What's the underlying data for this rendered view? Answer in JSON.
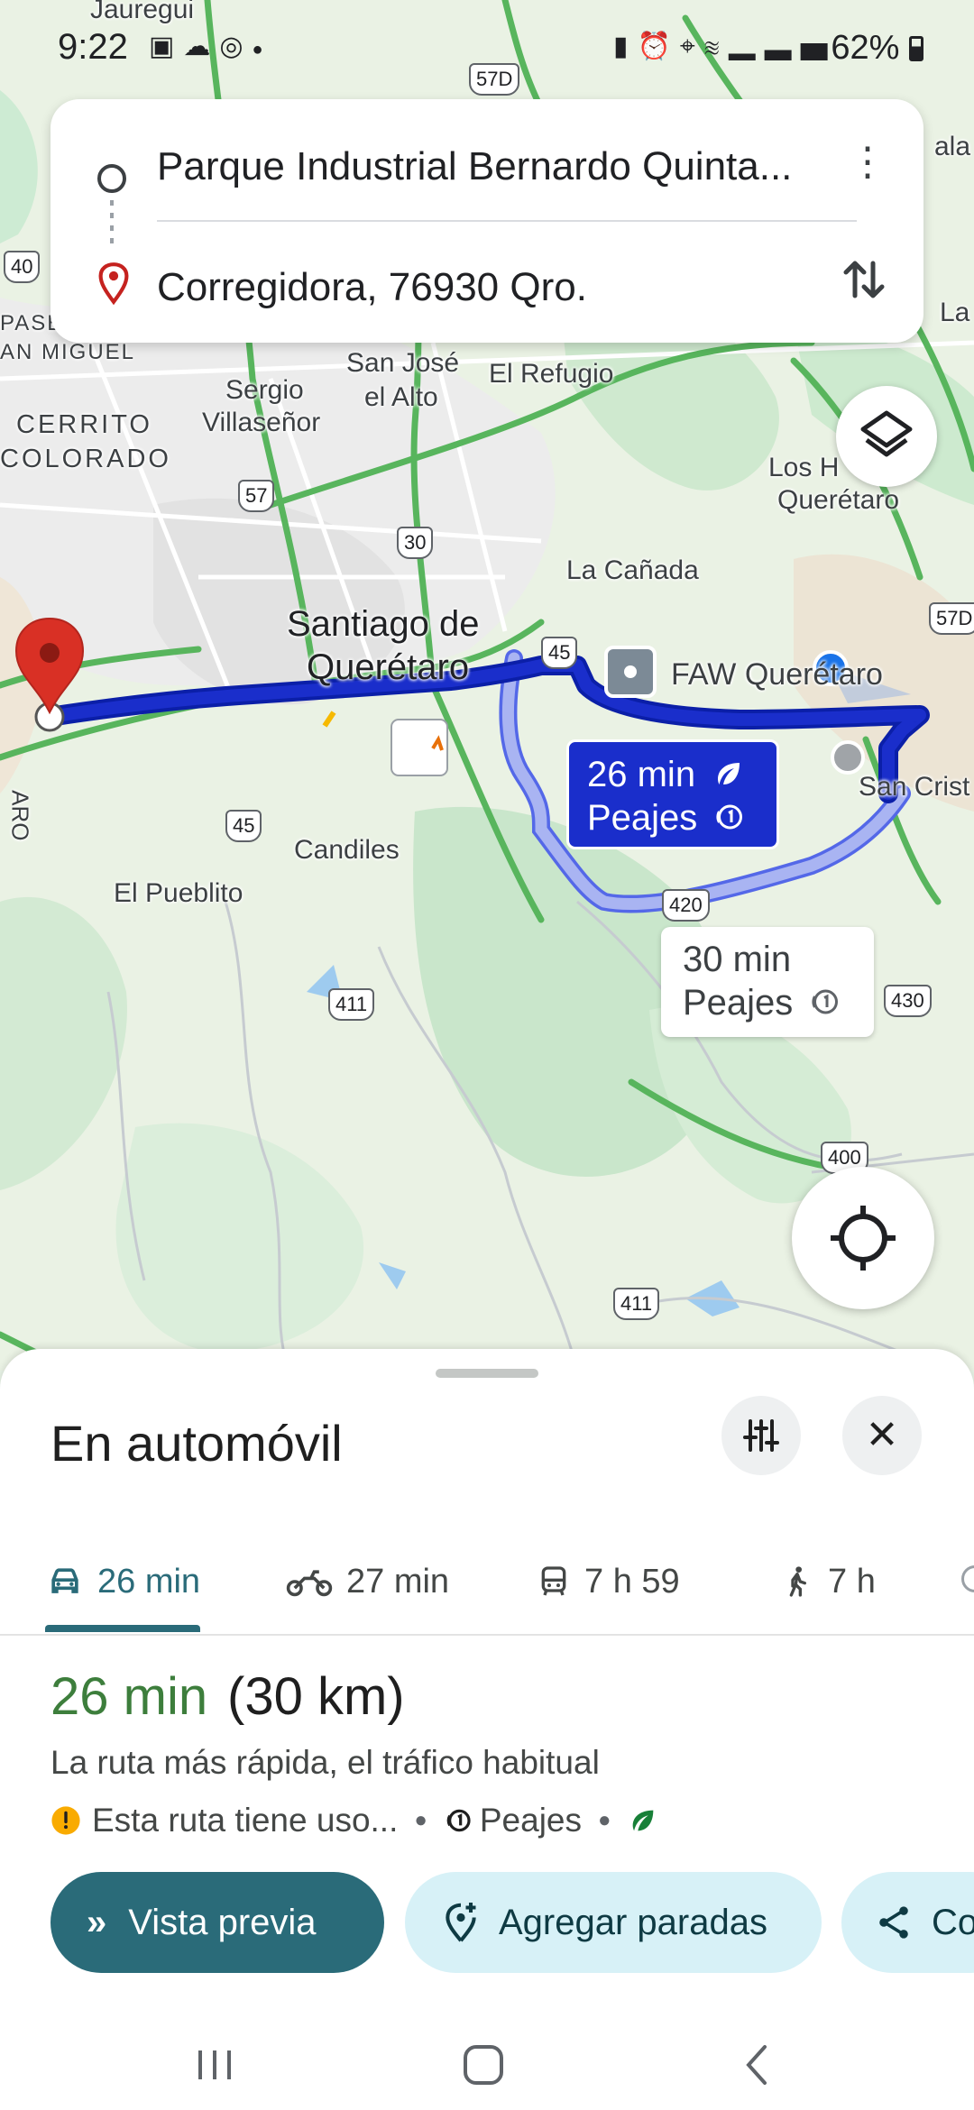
{
  "status_bar": {
    "time": "9:22",
    "left_icons": [
      "gallery-icon",
      "cloud-icon",
      "chrome-icon",
      "dot-icon"
    ],
    "right_icons": [
      "battery-saver-icon",
      "alarm-icon",
      "location-icon",
      "wifi-icon",
      "signal-icon"
    ],
    "battery": "62%"
  },
  "route_card": {
    "origin": "Parque Industrial Bernardo Quinta...",
    "destination": "Corregidora, 76930 Qro."
  },
  "map": {
    "labels": {
      "jauregui": "Jauregui",
      "pase": "PASE",
      "san_miguel": "AN MIGUEL",
      "cerrito": "CERRITO",
      "colorado": "COLORADO",
      "sergio": "Sergio",
      "villasenor": "Villaseñor",
      "san_jose": "San José",
      "el_alto": "el Alto",
      "el_refugio": "El Refugio",
      "los_h": "Los H",
      "queretaro_ne": "Querétaro",
      "la_canada": "La Cañada",
      "santiago1": "Santiago de",
      "santiago2": "Querétaro",
      "faw": "FAW Querétaro",
      "san_crist": "San Crist",
      "candiles": "Candiles",
      "el_pueblito": "El Pueblito",
      "ala": "ala",
      "la": "La",
      "aro": "ARO"
    },
    "shields": {
      "s57d_top": "57D",
      "s40": "40",
      "s57": "57",
      "s30": "30",
      "s45_top": "45",
      "s57d_right": "57D",
      "s45_bottom": "45",
      "s420": "420",
      "s411_a": "411",
      "s430": "430",
      "s400": "400",
      "s411_b": "411"
    },
    "route_main": {
      "time": "26 min",
      "tolls": "Peajes",
      "eco": true,
      "color": "#1a2ecb"
    },
    "route_alt": {
      "time": "30 min",
      "tolls": "Peajes",
      "color": "#a9b4f2"
    }
  },
  "sheet": {
    "title": "En automóvil",
    "tabs": [
      {
        "icon": "car-icon",
        "label": "26 min",
        "active": true
      },
      {
        "icon": "motorcycle-icon",
        "label": "27 min"
      },
      {
        "icon": "transit-icon",
        "label": "7 h 59"
      },
      {
        "icon": "walk-icon",
        "label": "7 h"
      }
    ],
    "summary": {
      "duration": "26 min",
      "distance": "(30 km)",
      "description": "La ruta más rápida, el tráfico habitual",
      "warning": "Esta ruta tiene uso...",
      "tolls": "Peajes"
    },
    "buttons": {
      "preview": "Vista previa",
      "add_stops": "Agregar paradas",
      "share": "Co"
    }
  },
  "colors": {
    "accent": "#2a6b79",
    "duration_green": "#3d7e3c",
    "route_blue": "#1a2ecb",
    "alt_route": "#a9b4f2",
    "pin_red": "#d93025"
  }
}
